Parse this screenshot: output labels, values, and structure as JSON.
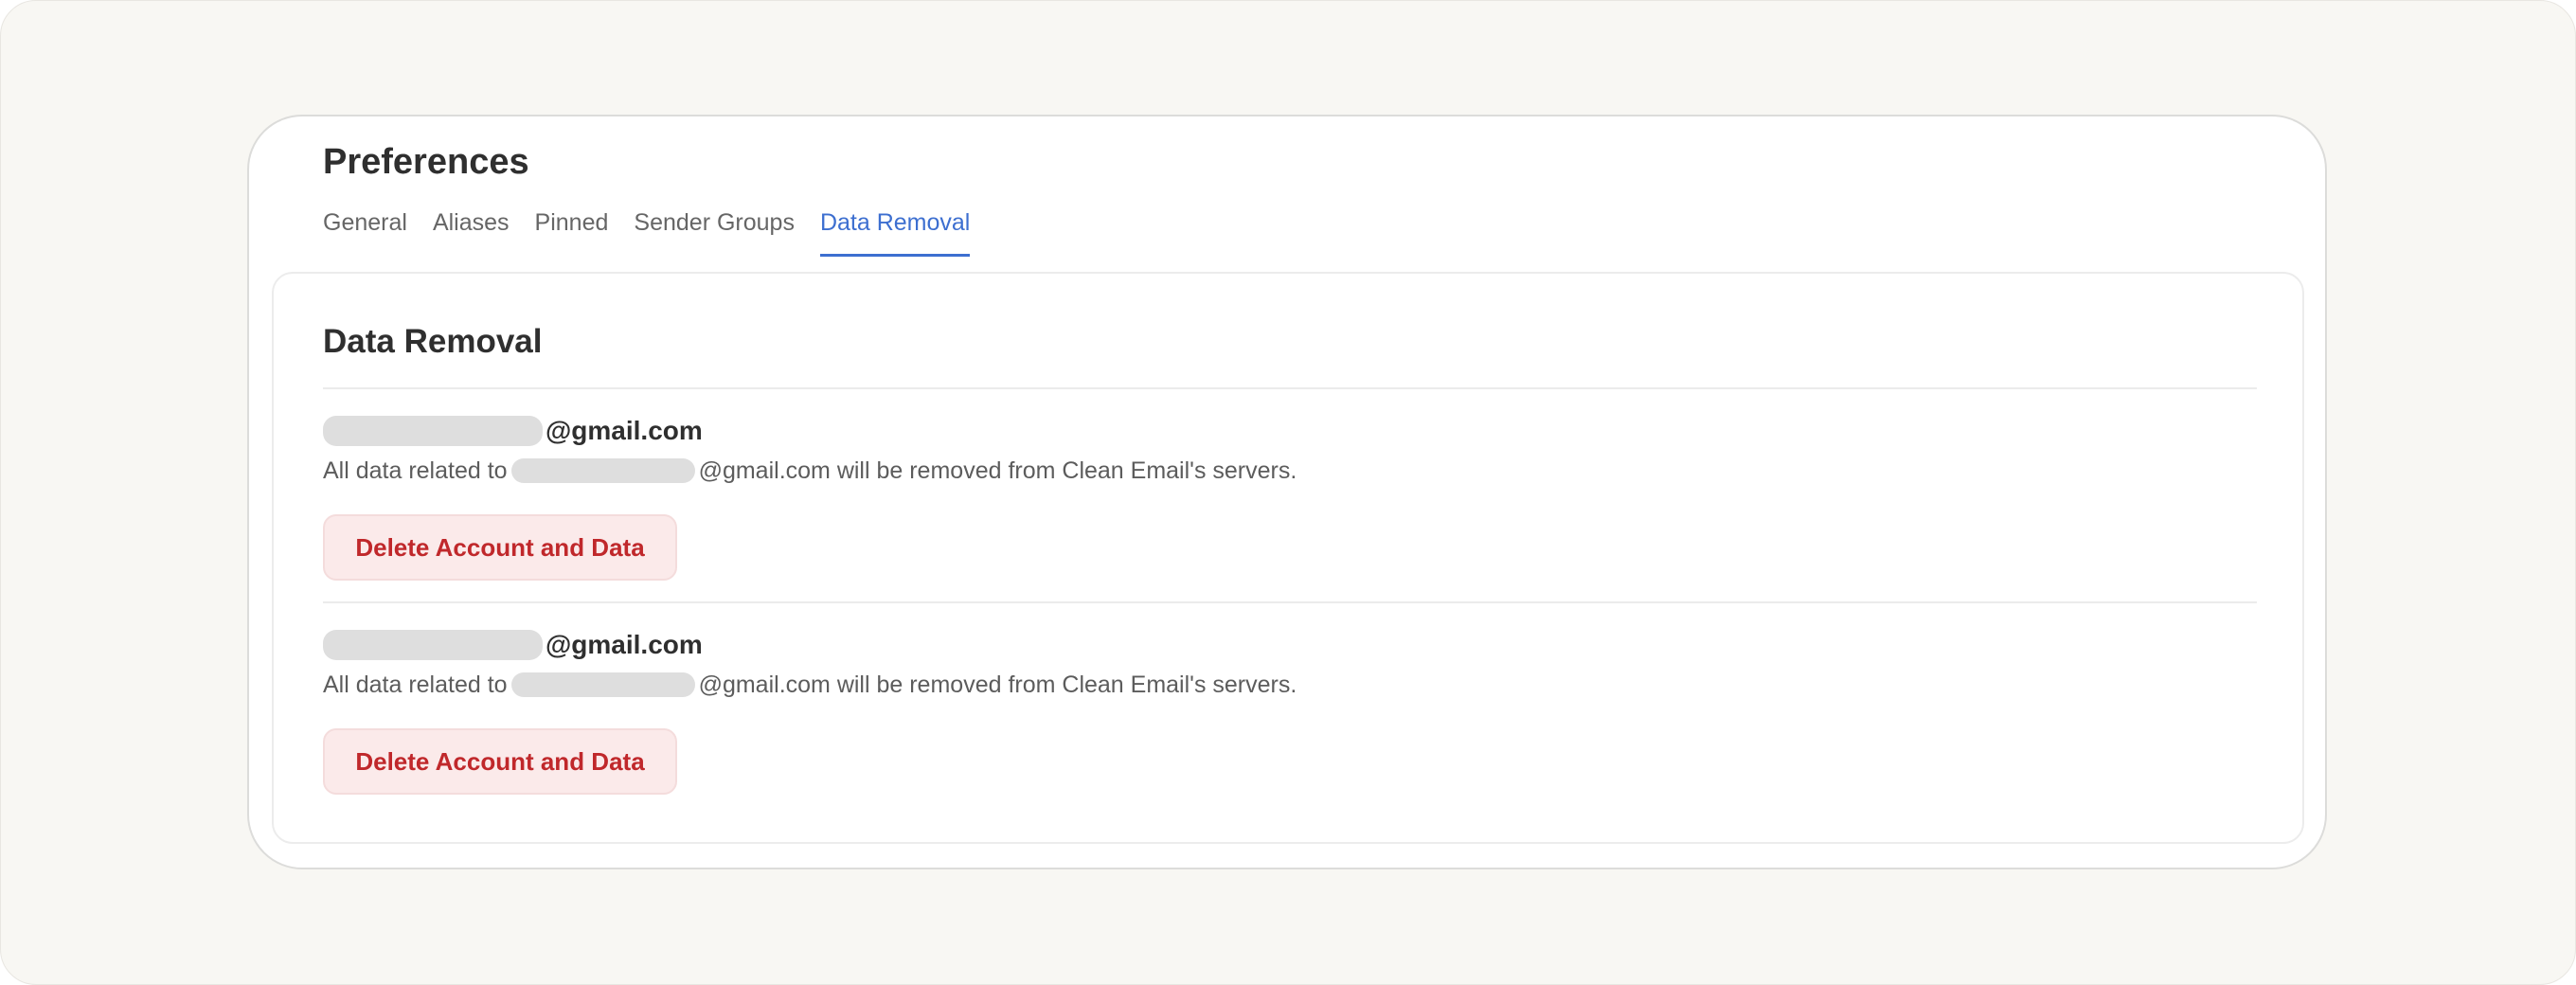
{
  "header": {
    "title": "Preferences"
  },
  "tabs": [
    {
      "label": "General",
      "active": false
    },
    {
      "label": "Aliases",
      "active": false
    },
    {
      "label": "Pinned",
      "active": false
    },
    {
      "label": "Sender Groups",
      "active": false
    },
    {
      "label": "Data Removal",
      "active": true
    }
  ],
  "panel": {
    "title": "Data Removal",
    "accounts": [
      {
        "email_domain": "@gmail.com",
        "desc_prefix": "All data related to",
        "desc_suffix": "@gmail.com will be removed from Clean Email's servers.",
        "button_label": "Delete Account and Data"
      },
      {
        "email_domain": "@gmail.com",
        "desc_prefix": "All data related to",
        "desc_suffix": "@gmail.com will be removed from Clean Email's servers.",
        "button_label": "Delete Account and Data"
      }
    ]
  },
  "colors": {
    "accent": "#3d6fd0",
    "danger_text": "#c0282b",
    "danger_bg": "#fbeaea",
    "page_bg": "#f8f7f3"
  }
}
